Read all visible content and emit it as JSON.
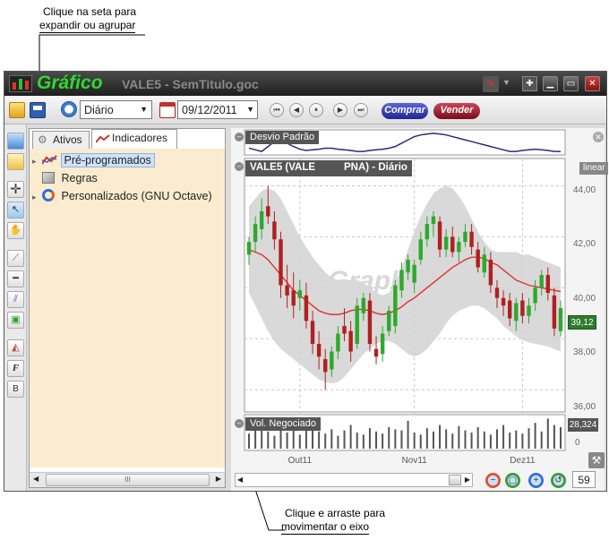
{
  "annotations": {
    "top": [
      "Clique na seta para",
      "expandir ou agrupar"
    ],
    "bottom": [
      "Clique e arraste para",
      "movimentar o eixo"
    ]
  },
  "window": {
    "app_name": "Gráfico",
    "document": "VALE5 - SemTitulo.goc",
    "controls": [
      "▁",
      "▭",
      "✕"
    ]
  },
  "toolbar": {
    "period_select": "Diário",
    "date_input": "09/12/2011",
    "nav_buttons": [
      "⏮",
      "◀",
      "⏸",
      "▶",
      "⏭"
    ],
    "buy_label": "Comprar",
    "sell_label": "Vender"
  },
  "sidebar": {
    "tabs": [
      "Ativos",
      "Indicadores"
    ],
    "tree": [
      {
        "label": "Pré-programados",
        "expander": "▸"
      },
      {
        "label": "Regras",
        "expander": ""
      },
      {
        "label": "Personalizados (GNU Octave)",
        "expander": "▸"
      }
    ],
    "scroll_thumb": "III",
    "scroll_left": "◀",
    "scroll_right": "▶"
  },
  "chart": {
    "std_panel_title": "Desvio Padrão",
    "main_panel_title": "VALE5 (VALE          PNA) - Diário",
    "scale_label": "linear",
    "last_price": "39,12",
    "price_ticks": [
      "44,00",
      "42,00",
      "40,00",
      "38,00",
      "36,00"
    ],
    "volume_title": "Vol. Negociado",
    "volume_last": "28,324",
    "volume_zero": "0",
    "x_ticks": [
      "Out11",
      "Nov11",
      "Dez11"
    ],
    "watermark": "GraphOC",
    "watermark_sub": ".com",
    "zoom_value": "59"
  },
  "colors": {
    "bull": "#2ea82e",
    "bear": "#b02020",
    "band": "#d2d2d2",
    "sma": "#e03030",
    "std_line": "#2a2a7a",
    "buy_btn": "#2b35a8",
    "sell_btn": "#9a1a2a",
    "app_name": "#3ed03e"
  },
  "chart_data": {
    "type": "candlestick",
    "candles": [
      {
        "o": 41.3,
        "h": 42.0,
        "l": 40.9,
        "c": 41.8
      },
      {
        "o": 41.8,
        "h": 42.8,
        "l": 41.4,
        "c": 42.5
      },
      {
        "o": 42.3,
        "h": 43.5,
        "l": 41.9,
        "c": 43.0
      },
      {
        "o": 43.2,
        "h": 44.0,
        "l": 42.5,
        "c": 42.8
      },
      {
        "o": 42.6,
        "h": 43.0,
        "l": 41.5,
        "c": 41.9
      },
      {
        "o": 41.9,
        "h": 42.2,
        "l": 39.6,
        "c": 40.1
      },
      {
        "o": 40.1,
        "h": 40.9,
        "l": 39.2,
        "c": 39.7
      },
      {
        "o": 39.9,
        "h": 40.6,
        "l": 38.8,
        "c": 39.3
      },
      {
        "o": 39.6,
        "h": 40.3,
        "l": 39.1,
        "c": 39.9
      },
      {
        "o": 39.7,
        "h": 40.2,
        "l": 38.4,
        "c": 38.7
      },
      {
        "o": 38.7,
        "h": 39.1,
        "l": 37.4,
        "c": 37.8
      },
      {
        "o": 37.8,
        "h": 38.3,
        "l": 36.8,
        "c": 37.3
      },
      {
        "o": 37.2,
        "h": 37.6,
        "l": 36.0,
        "c": 36.7
      },
      {
        "o": 36.8,
        "h": 37.7,
        "l": 36.5,
        "c": 37.5
      },
      {
        "o": 37.5,
        "h": 38.5,
        "l": 37.2,
        "c": 38.2
      },
      {
        "o": 38.5,
        "h": 39.2,
        "l": 37.9,
        "c": 38.2
      },
      {
        "o": 38.3,
        "h": 38.7,
        "l": 37.1,
        "c": 37.5
      },
      {
        "o": 37.8,
        "h": 39.6,
        "l": 37.6,
        "c": 39.3
      },
      {
        "o": 39.0,
        "h": 39.8,
        "l": 38.7,
        "c": 39.6
      },
      {
        "o": 39.5,
        "h": 39.8,
        "l": 37.5,
        "c": 37.8
      },
      {
        "o": 37.6,
        "h": 38.1,
        "l": 37.0,
        "c": 37.3
      },
      {
        "o": 37.4,
        "h": 38.5,
        "l": 37.1,
        "c": 38.2
      },
      {
        "o": 38.3,
        "h": 39.3,
        "l": 38.1,
        "c": 39.1
      },
      {
        "o": 38.5,
        "h": 40.3,
        "l": 38.2,
        "c": 40.1
      },
      {
        "o": 39.9,
        "h": 41.0,
        "l": 39.6,
        "c": 40.7
      },
      {
        "o": 40.6,
        "h": 41.3,
        "l": 40.3,
        "c": 41.1
      },
      {
        "o": 40.2,
        "h": 41.1,
        "l": 39.8,
        "c": 40.9
      },
      {
        "o": 41.1,
        "h": 42.2,
        "l": 40.9,
        "c": 41.9
      },
      {
        "o": 41.9,
        "h": 42.8,
        "l": 41.6,
        "c": 42.5
      },
      {
        "o": 42.5,
        "h": 43.0,
        "l": 42.0,
        "c": 42.8
      },
      {
        "o": 42.6,
        "h": 42.8,
        "l": 41.2,
        "c": 41.5
      },
      {
        "o": 41.5,
        "h": 42.3,
        "l": 41.2,
        "c": 42.0
      },
      {
        "o": 42.0,
        "h": 42.4,
        "l": 41.2,
        "c": 41.4
      },
      {
        "o": 41.4,
        "h": 42.0,
        "l": 41.0,
        "c": 41.8
      },
      {
        "o": 41.8,
        "h": 42.5,
        "l": 41.6,
        "c": 42.2
      },
      {
        "o": 42.2,
        "h": 42.5,
        "l": 41.3,
        "c": 41.6
      },
      {
        "o": 41.5,
        "h": 41.8,
        "l": 40.6,
        "c": 40.8
      },
      {
        "o": 40.6,
        "h": 41.6,
        "l": 40.4,
        "c": 41.3
      },
      {
        "o": 41.1,
        "h": 41.4,
        "l": 39.8,
        "c": 40.1
      },
      {
        "o": 40.0,
        "h": 40.3,
        "l": 39.2,
        "c": 39.6
      },
      {
        "o": 39.6,
        "h": 39.9,
        "l": 38.9,
        "c": 39.3
      },
      {
        "o": 39.5,
        "h": 39.8,
        "l": 38.5,
        "c": 38.8
      },
      {
        "o": 38.7,
        "h": 39.6,
        "l": 38.3,
        "c": 39.4
      },
      {
        "o": 39.5,
        "h": 39.8,
        "l": 38.6,
        "c": 38.9
      },
      {
        "o": 38.9,
        "h": 39.6,
        "l": 38.6,
        "c": 39.3
      },
      {
        "o": 39.4,
        "h": 40.3,
        "l": 39.1,
        "c": 40.0
      },
      {
        "o": 40.0,
        "h": 40.7,
        "l": 39.7,
        "c": 40.5
      },
      {
        "o": 40.5,
        "h": 40.8,
        "l": 39.5,
        "c": 39.8
      },
      {
        "o": 39.7,
        "h": 40.0,
        "l": 38.1,
        "c": 38.4
      },
      {
        "o": 38.3,
        "h": 39.5,
        "l": 38.1,
        "c": 39.2
      }
    ],
    "sma": [
      41.5,
      41.4,
      41.3,
      41.1,
      40.8,
      40.5,
      40.2,
      39.9,
      39.7,
      39.5,
      39.3,
      39.1,
      39.0,
      38.95,
      38.95,
      39.0,
      39.1,
      39.15,
      39.15,
      39.1,
      39.0,
      38.95,
      39.0,
      39.1,
      39.25,
      39.45,
      39.6,
      39.8,
      40.0,
      40.2,
      40.4,
      40.6,
      40.8,
      40.95,
      41.1,
      41.2,
      41.2,
      41.15,
      41.0,
      40.9,
      40.7,
      40.5,
      40.3,
      40.2,
      40.1,
      40.05,
      40.0,
      39.95,
      39.9,
      39.85
    ],
    "band_upper": [
      43.2,
      43.5,
      43.8,
      43.9,
      43.8,
      43.5,
      43.0,
      42.5,
      42.0,
      41.6,
      41.2,
      40.9,
      40.6,
      40.4,
      40.3,
      40.3,
      40.3,
      40.3,
      40.2,
      40.0,
      39.8,
      39.7,
      39.8,
      40.2,
      40.8,
      41.5,
      42.2,
      42.8,
      43.3,
      43.7,
      43.9,
      44.0,
      43.9,
      43.6,
      43.2,
      42.7,
      42.2,
      41.8,
      41.5,
      41.4,
      41.4,
      41.4,
      41.4,
      41.3,
      41.3,
      41.2,
      41.1,
      41.0,
      40.9,
      40.8
    ],
    "band_lower": [
      39.8,
      39.3,
      38.8,
      38.3,
      37.9,
      37.6,
      37.4,
      37.2,
      37.0,
      36.8,
      36.6,
      36.4,
      36.3,
      36.25,
      36.3,
      36.5,
      36.8,
      37.1,
      37.4,
      37.6,
      37.8,
      37.9,
      37.9,
      37.8,
      37.6,
      37.4,
      37.3,
      37.4,
      37.6,
      37.9,
      38.2,
      38.6,
      38.9,
      39.1,
      39.2,
      39.3,
      39.3,
      39.2,
      39.0,
      38.8,
      38.5,
      38.3,
      38.1,
      37.95,
      37.85,
      37.8,
      37.75,
      37.7,
      37.6,
      37.5
    ],
    "std_dev": [
      0.55,
      0.5,
      0.45,
      0.6,
      0.75,
      0.8,
      0.7,
      0.6,
      0.52,
      0.48,
      0.5,
      0.52,
      0.55,
      0.55,
      0.52,
      0.5,
      0.48,
      0.45,
      0.45,
      0.48,
      0.5,
      0.52,
      0.55,
      0.6,
      0.7,
      0.8,
      0.9,
      0.95,
      0.98,
      1.0,
      0.98,
      0.95,
      0.9,
      0.85,
      0.8,
      0.75,
      0.7,
      0.65,
      0.6,
      0.55,
      0.5,
      0.45,
      0.45,
      0.48,
      0.5,
      0.52,
      0.5,
      0.48,
      0.45,
      0.45
    ],
    "volume": [
      14,
      18,
      22,
      16,
      12,
      20,
      15,
      17,
      13,
      19,
      21,
      16,
      14,
      18,
      12,
      17,
      22,
      15,
      13,
      19,
      16,
      14,
      20,
      18,
      17,
      26,
      15,
      13,
      19,
      16,
      22,
      18,
      14,
      21,
      17,
      15,
      20,
      16,
      13,
      18,
      22,
      15,
      17,
      14,
      19,
      24,
      16,
      28,
      22,
      20
    ],
    "ylim": [
      35.2,
      45.0
    ],
    "x_tick_index": [
      8,
      26,
      43
    ]
  }
}
